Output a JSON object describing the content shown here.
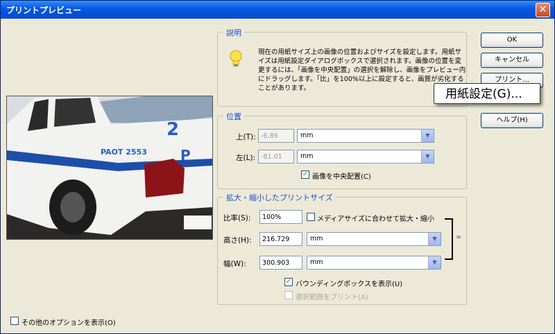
{
  "window": {
    "title": "プリントプレビュー"
  },
  "description": {
    "legend": "説明",
    "text": "現在の用紙サイズ上の画像の位置およびサイズを設定します。用紙サイズは用紙設定ダイアログボックスで選択されます。画像の位置を変更するには、「画像を中央配置」の選択を解除し、画像をプレビュー内にドラッグします。「比」を100%以上に設定すると、画質が劣化することがあります。"
  },
  "position": {
    "legend": "位置",
    "top_label": "上(T):",
    "top_value": "-6.89",
    "top_unit": "mm",
    "left_label": "左(L):",
    "left_value": "-81.01",
    "left_unit": "mm",
    "center_label": "画像を中央配置(C)",
    "center_checked": true
  },
  "scaled": {
    "legend": "拡大・縮小したプリントサイズ",
    "scale_label": "比率(S):",
    "scale_value": "100%",
    "fit_label": "メディアサイズに合わせて拡大・縮小",
    "height_label": "高さ(H):",
    "height_value": "216.729",
    "height_unit": "mm",
    "width_label": "幅(W):",
    "width_value": "300.903",
    "width_unit": "mm",
    "bbox_label": "バウンディングボックスを表示(U)",
    "bbox_checked": true,
    "selection_label": "選択範囲をプリント(A)"
  },
  "buttons": {
    "ok": "OK",
    "cancel": "キャンセル",
    "print": "プリント...",
    "help": "ヘルプ(H)"
  },
  "tooltip": "用紙設定(G)...",
  "options_label": "その他のオプションを表示(O)"
}
